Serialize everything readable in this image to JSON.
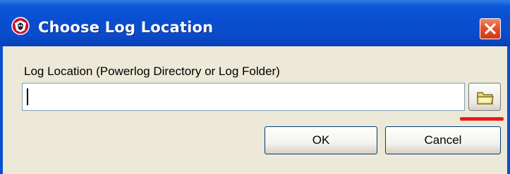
{
  "window": {
    "title": "Choose Log Location",
    "title_icon": "app-logo-icon",
    "close_icon": "close-icon"
  },
  "form": {
    "label": "Log Location (Powerlog Directory or Log Folder)",
    "path_value": "",
    "path_placeholder": "",
    "browse_icon": "folder-icon"
  },
  "buttons": {
    "ok_label": "OK",
    "cancel_label": "Cancel"
  },
  "colors": {
    "titlebar": "#0a4fd1",
    "close_button": "#e5512b",
    "dialog_face": "#ece9d8",
    "annotation_underline": "#e81c1c"
  }
}
